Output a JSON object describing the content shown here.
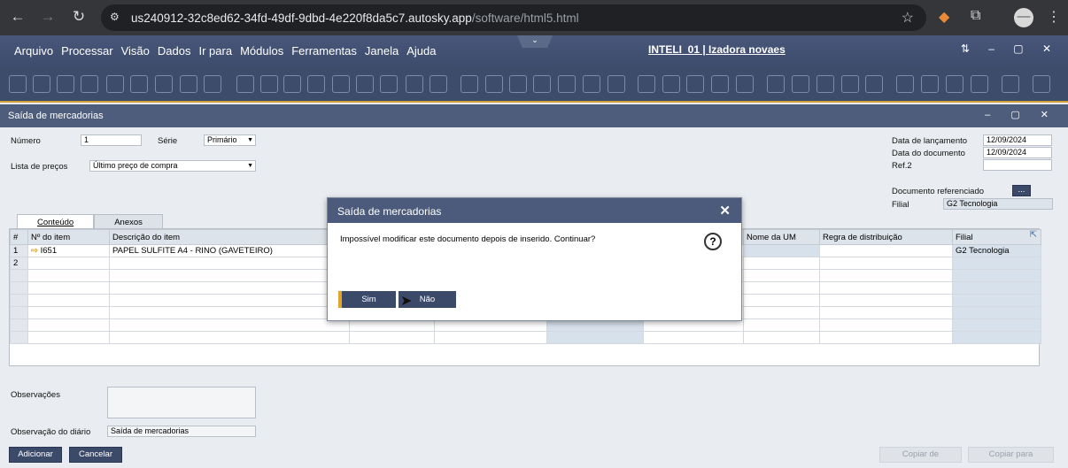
{
  "browser": {
    "url_main": "us240912-32c8ed62-34fd-49df-9dbd-4e220f8da5c7.autosky.app",
    "url_path": "/software/html5.html"
  },
  "app": {
    "menu": [
      "Arquivo",
      "Processar",
      "Visão",
      "Dados",
      "Ir para",
      "Módulos",
      "Ferramentas",
      "Janela",
      "Ajuda"
    ],
    "company": "INTELI_01 | Izadora novaes"
  },
  "window": {
    "title": "Saída de mercadorias"
  },
  "header": {
    "numero_label": "Número",
    "numero_value": "1",
    "serie_label": "Série",
    "serie_value": "Primário",
    "lista_label": "Lista de preços",
    "lista_value": "Último preço de compra",
    "data_lanc_label": "Data de lançamento",
    "data_lanc_value": "12/09/2024",
    "data_doc_label": "Data do documento",
    "data_doc_value": "12/09/2024",
    "ref2_label": "Ref.2",
    "doc_ref_label": "Documento referenciado",
    "doc_ref_button": "...",
    "filial_label": "Filial",
    "filial_value": "G2 Tecnologia"
  },
  "tabs": [
    "Conteúdo",
    "Anexos"
  ],
  "grid": {
    "columns": [
      "#",
      "Nº do item",
      "Descrição do item",
      "",
      "",
      "",
      "",
      "Nome da UM",
      "Regra de distribuição",
      "Filial"
    ],
    "rows": [
      {
        "num": "1",
        "item": "I651",
        "desc": "PAPEL SULFITE A4 - RINO (GAVETEIRO)",
        "filial": "G2 Tecnologia"
      },
      {
        "num": "2",
        "item": "",
        "desc": "",
        "filial": ""
      }
    ]
  },
  "footer": {
    "obs_label": "Observações",
    "obs_diario_label": "Observação do diário",
    "obs_diario_value": "Saída de mercadorias",
    "add_button": "Adicionar",
    "cancel_button": "Cancelar",
    "copy_from_button": "Copiar de",
    "copy_to_button": "Copiar para"
  },
  "dialog": {
    "title": "Saída de mercadorias",
    "message": "Impossível modificar este documento depois de inserido. Continuar?",
    "yes": "Sim",
    "no": "Não"
  }
}
